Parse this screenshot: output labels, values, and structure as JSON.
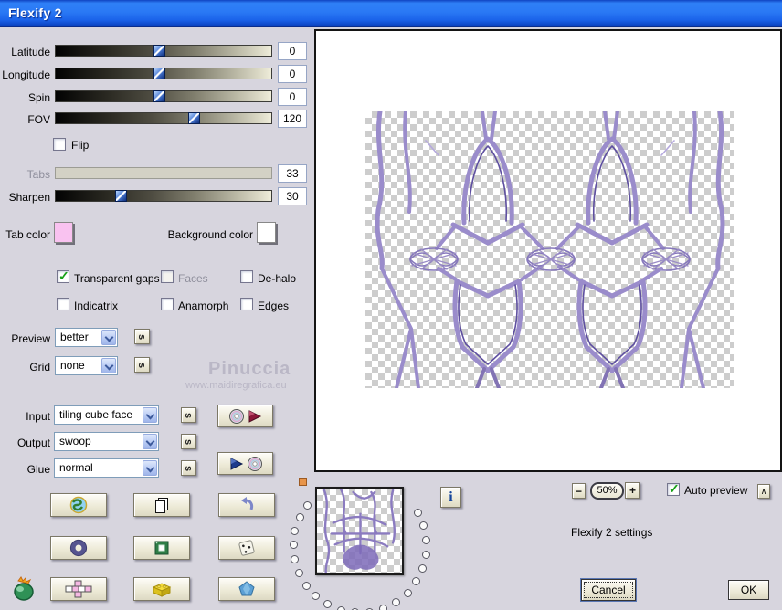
{
  "window": {
    "title": "Flexify 2"
  },
  "sliders": [
    {
      "label": "Latitude",
      "value": "0",
      "percent": 48,
      "disabled": false
    },
    {
      "label": "Longitude",
      "value": "0",
      "percent": 48,
      "disabled": false
    },
    {
      "label": "Spin",
      "value": "0",
      "percent": 48,
      "disabled": false
    },
    {
      "label": "FOV",
      "value": "120",
      "percent": 64,
      "disabled": false
    }
  ],
  "flip": {
    "label": "Flip",
    "checked": false
  },
  "tabs_slider": {
    "label": "Tabs",
    "value": "33",
    "disabled": true
  },
  "sharpen_slider": {
    "label": "Sharpen",
    "value": "30",
    "percent": 30,
    "disabled": false
  },
  "color_pickers": {
    "tab_color_label": "Tab color",
    "tab_color": "#f9c2f0",
    "background_color_label": "Background color",
    "background_color": "#ffffff"
  },
  "options": [
    {
      "label": "Transparent gaps",
      "checked": true,
      "disabled": false
    },
    {
      "label": "Faces",
      "checked": false,
      "disabled": true
    },
    {
      "label": "De-halo",
      "checked": false,
      "disabled": false
    },
    {
      "label": "Indicatrix",
      "checked": false,
      "disabled": false
    },
    {
      "label": "Anamorph",
      "checked": false,
      "disabled": false
    },
    {
      "label": "Edges",
      "checked": false,
      "disabled": false
    }
  ],
  "selects": {
    "s_button_label": "s",
    "preview": {
      "label": "Preview",
      "value": "better"
    },
    "grid": {
      "label": "Grid",
      "value": "none"
    },
    "input": {
      "label": "Input",
      "value": "tiling cube face"
    },
    "output": {
      "label": "Output",
      "value": "swoop"
    },
    "glue": {
      "label": "Glue",
      "value": "normal"
    }
  },
  "watermark": {
    "line1": "Pinuccia",
    "line2": "www.maidiregrafica.eu"
  },
  "icon_buttons": [
    "globe",
    "copy-pages",
    "undo",
    "torus",
    "green-frame",
    "dice",
    "cube-net",
    "lego-brick",
    "pentagon-gem"
  ],
  "cd_buttons": [
    "save-settings-cd",
    "load-settings-cd"
  ],
  "logo": "flaming-pear-green-pear",
  "center": {
    "info_label": "i"
  },
  "footer": {
    "zoom_out": "−",
    "zoom_level": "50%",
    "zoom_in": "+",
    "auto_preview_label": "Auto preview",
    "auto_preview_checked": true,
    "arrow_button_label": "∧",
    "settings_text": "Flexify 2 settings",
    "cancel_label": "Cancel",
    "ok_label": "OK"
  },
  "colors": {
    "dialog_bg": "#d7d5de",
    "titlebar_blue": "#1b63ea",
    "button_face": "#ece9d8",
    "pattern_purple": "#9a8ccb",
    "value_border": "#96a5c5"
  }
}
